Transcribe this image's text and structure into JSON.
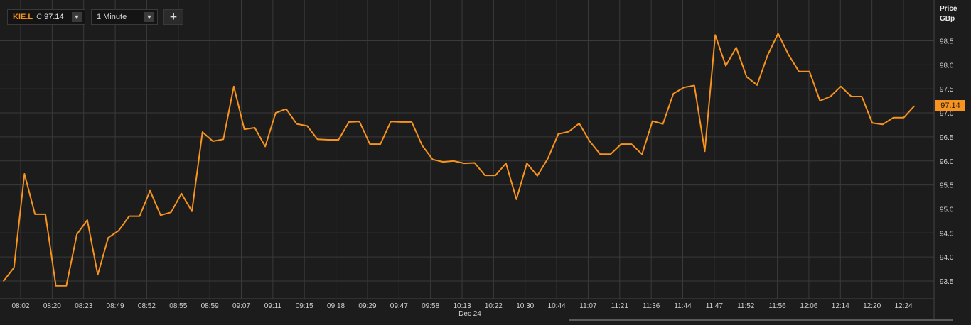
{
  "toolbar": {
    "symbol": "KIE.L",
    "price_prefix": "C",
    "price": "97.14",
    "interval": "1 Minute",
    "add_label": "+"
  },
  "axis": {
    "title_line1": "Price",
    "title_line2": "GBp",
    "last_value_label": "97.14"
  },
  "colors": {
    "background": "#1c1c1c",
    "grid": "#3a3a3a",
    "line": "#f7931e",
    "tag": "#f7931e"
  },
  "chart_data": {
    "type": "line",
    "title": "",
    "xlabel": "",
    "ylabel": "Price GBp",
    "ylim": [
      93.2,
      98.9
    ],
    "y_ticks": [
      "93.5",
      "94.0",
      "94.5",
      "95.0",
      "95.5",
      "96.0",
      "96.5",
      "97.0",
      "97.5",
      "98.0",
      "98.5"
    ],
    "x_ticks": [
      "08:02",
      "08:20",
      "08:23",
      "08:49",
      "08:52",
      "08:55",
      "08:59",
      "09:07",
      "09:11",
      "09:15",
      "09:18",
      "09:29",
      "09:47",
      "09:58",
      "10:13",
      "10:22",
      "10:30",
      "10:44",
      "11:07",
      "11:21",
      "11:36",
      "11:44",
      "11:47",
      "11:52",
      "11:56",
      "12:06",
      "12:14",
      "12:20",
      "12:24"
    ],
    "date_label": "Dec 24",
    "grid": true,
    "series": [
      {
        "values": [
          93.5,
          93.78,
          95.73,
          94.89,
          94.89,
          93.4,
          93.4,
          94.47,
          94.77,
          93.63,
          94.4,
          94.55,
          94.85,
          94.85,
          95.38,
          94.87,
          94.93,
          95.32,
          94.95,
          96.6,
          96.41,
          96.45,
          97.55,
          96.66,
          96.69,
          96.3,
          97.0,
          97.08,
          96.77,
          96.73,
          96.45,
          96.44,
          96.44,
          96.81,
          96.82,
          96.35,
          96.35,
          96.82,
          96.81,
          96.81,
          96.32,
          96.03,
          95.98,
          96.0,
          95.95,
          95.96,
          95.7,
          95.7,
          95.95,
          95.2,
          95.95,
          95.69,
          96.05,
          96.56,
          96.61,
          96.78,
          96.41,
          96.14,
          96.14,
          96.35,
          96.35,
          96.14,
          96.83,
          96.77,
          97.4,
          97.53,
          97.57,
          96.2,
          98.62,
          97.98,
          98.36,
          97.75,
          97.58,
          98.2,
          98.65,
          98.21,
          97.86,
          97.86,
          97.25,
          97.34,
          97.55,
          97.34,
          97.34,
          96.79,
          96.76,
          96.9,
          96.9,
          97.14
        ]
      }
    ]
  }
}
